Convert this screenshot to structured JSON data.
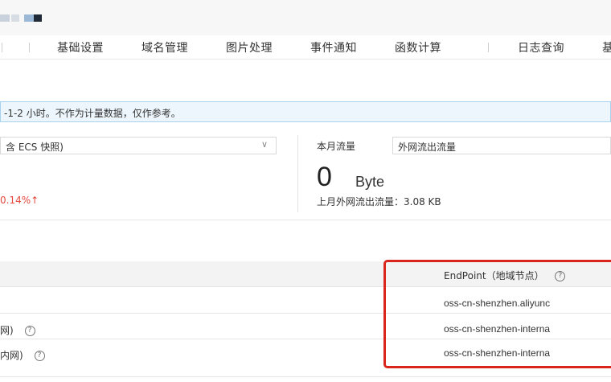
{
  "nav": {
    "tabs": [
      "基础设置",
      "域名管理",
      "图片处理",
      "事件通知",
      "函数计算",
      "日志查询",
      "基"
    ]
  },
  "notice": {
    "text": "-1-2 小时。不作为计量数据，仅作参考。"
  },
  "storage": {
    "select_value": "含 ECS 快照)",
    "change_pct": "0.14%↑"
  },
  "traffic": {
    "label": "本月流量",
    "select_value": "外网流出流量",
    "value": "0",
    "unit": "Byte",
    "last_month": "上月外网流出流量：3.08 KB"
  },
  "endpoint_table": {
    "header": "EndPoint（地域节点）",
    "rows": [
      {
        "label": "",
        "endpoint": "oss-cn-shenzhen.aliyunc"
      },
      {
        "label": "网)",
        "endpoint": "oss-cn-shenzhen-interna"
      },
      {
        "label": "内网)",
        "endpoint": "oss-cn-shenzhen-interna"
      }
    ]
  },
  "colors": {
    "highlight": "#d9251c",
    "increase": "#e5473c",
    "notice_bg": "#edf6fc"
  }
}
